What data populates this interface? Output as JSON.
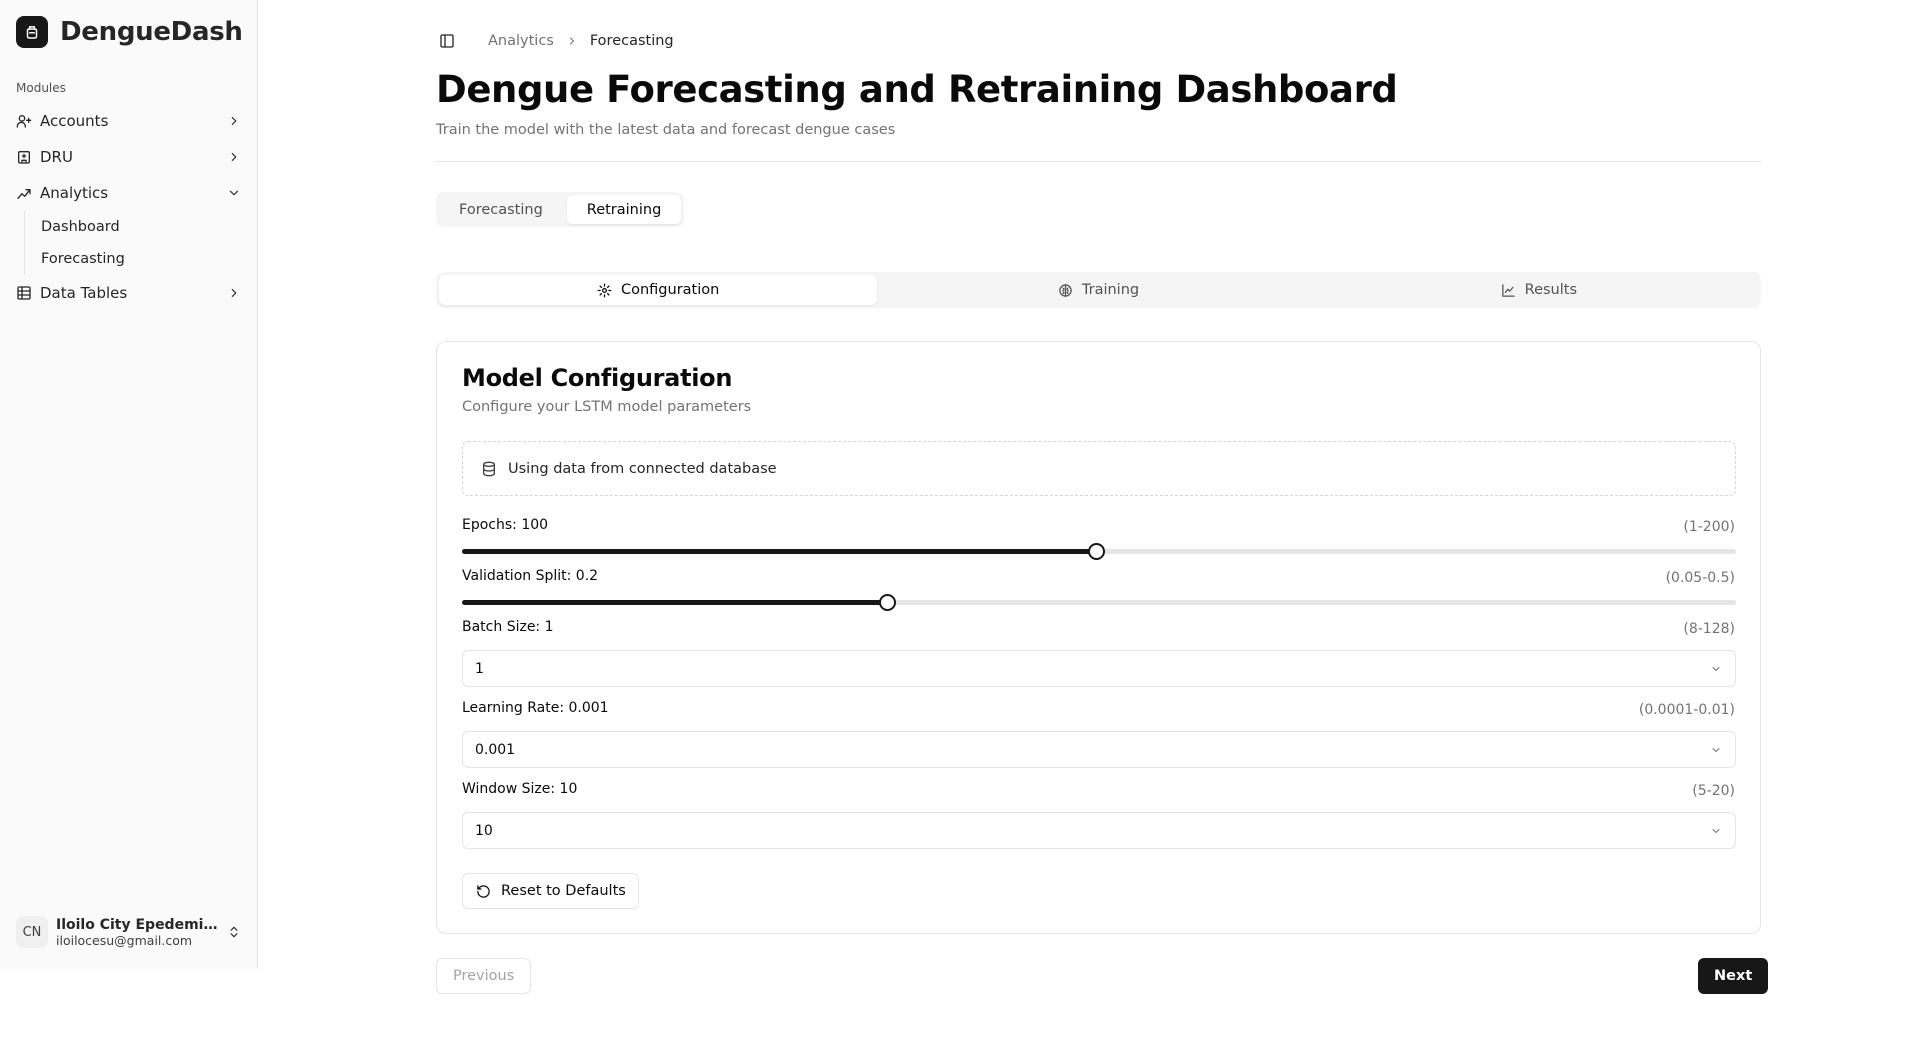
{
  "app": {
    "name": "DengueDash"
  },
  "sidebar": {
    "section_label": "Modules",
    "items": [
      {
        "label": "Accounts",
        "icon": "user-plus-icon",
        "chevron": "chevron-right-icon"
      },
      {
        "label": "DRU",
        "icon": "hospital-icon",
        "chevron": "chevron-right-icon"
      },
      {
        "label": "Analytics",
        "icon": "analytics-icon",
        "chevron": "chevron-down-icon",
        "expanded": true,
        "children": [
          {
            "label": "Dashboard"
          },
          {
            "label": "Forecasting"
          }
        ]
      },
      {
        "label": "Data Tables",
        "icon": "table-icon",
        "chevron": "chevron-right-icon"
      }
    ],
    "user": {
      "initials": "CN",
      "name": "Iloilo City Epedemiol...",
      "email": "iloilocesu@gmail.com"
    }
  },
  "breadcrumb": {
    "parent": "Analytics",
    "current": "Forecasting"
  },
  "header": {
    "title": "Dengue Forecasting and Retraining Dashboard",
    "subtitle": "Train the model with the latest data and forecast dengue cases"
  },
  "tabs_outer": [
    {
      "label": "Forecasting",
      "active": false
    },
    {
      "label": "Retraining",
      "active": true
    }
  ],
  "tabs_inner": [
    {
      "label": "Configuration",
      "icon": "gear-icon",
      "active": true
    },
    {
      "label": "Training",
      "icon": "brain-icon",
      "active": false
    },
    {
      "label": "Results",
      "icon": "line-chart-icon",
      "active": false
    }
  ],
  "config": {
    "title": "Model Configuration",
    "subtitle": "Configure your LSTM model parameters",
    "data_source": "Using data from connected database",
    "epochs": {
      "label": "Epochs: 100",
      "range": "(1-200)",
      "value": 100,
      "min": 1,
      "max": 200
    },
    "validation_split": {
      "label": "Validation Split: 0.2",
      "range": "(0.05-0.5)",
      "value": 0.2,
      "min": 0.05,
      "max": 0.5
    },
    "batch_size": {
      "label": "Batch Size: 1",
      "range": "(8-128)",
      "value": "1"
    },
    "learning_rate": {
      "label": "Learning Rate: 0.001",
      "range": "(0.0001-0.01)",
      "value": "0.001"
    },
    "window_size": {
      "label": "Window Size: 10",
      "range": "(5-20)",
      "value": "10"
    },
    "reset_label": "Reset to Defaults"
  },
  "footer": {
    "previous_label": "Previous",
    "next_label": "Next"
  },
  "colors": {
    "accent": "#171717",
    "muted_text": "#737373",
    "border": "#e5e5e5",
    "tab_bg": "#f5f5f5"
  }
}
